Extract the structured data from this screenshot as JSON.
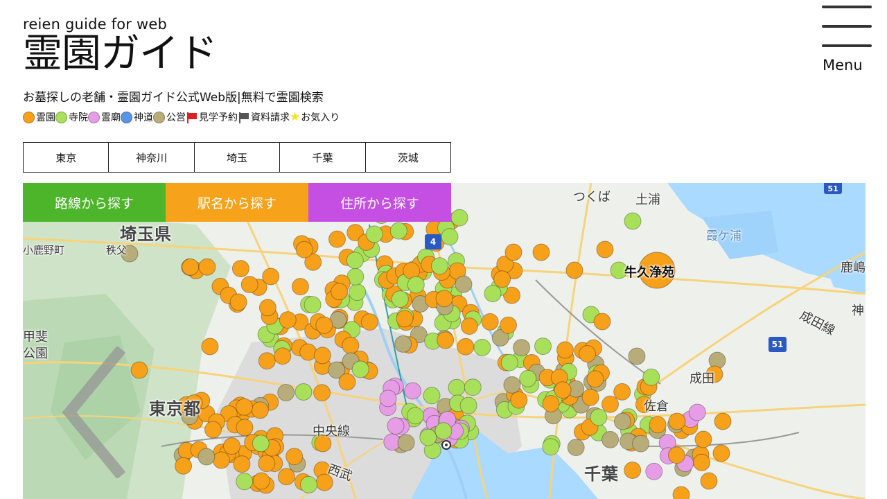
{
  "header": {
    "subtitle": "reien guide for web",
    "title": "霊園ガイド",
    "tagline": "お墓探しの老舗・霊園ガイド公式Web版|無料で霊園検索"
  },
  "legend": [
    {
      "label": "霊園",
      "icon": "orange-dot-icon",
      "color": "#f7a01a"
    },
    {
      "label": "寺院",
      "icon": "green-dot-icon",
      "color": "#a8e05a"
    },
    {
      "label": "霊廟",
      "icon": "pink-dot-icon",
      "color": "#e79ce6"
    },
    {
      "label": "神道",
      "icon": "blue-dot-icon",
      "color": "#5a94e8"
    },
    {
      "label": "公営",
      "icon": "olive-dot-icon",
      "color": "#b8ad79"
    },
    {
      "label": "見学予約",
      "icon": "red-flag-icon",
      "color": "#e02020"
    },
    {
      "label": "資料請求",
      "icon": "gray-flag-icon",
      "color": "#555555"
    },
    {
      "label": "お気入り",
      "icon": "star-icon",
      "color": "#f7e600"
    }
  ],
  "menu": {
    "label": "Menu"
  },
  "prefecture_tabs": [
    "東京",
    "神奈川",
    "埼玉",
    "千葉",
    "茨城"
  ],
  "search_tabs": [
    {
      "label": "路線から探す",
      "color": "#4cb52a"
    },
    {
      "label": "駅名から探す",
      "color": "#f7a21b"
    },
    {
      "label": "住所から探す",
      "color": "#c54ee3"
    }
  ],
  "map_labels": {
    "saitama": "埼玉県",
    "kanohara": "小鹿野町",
    "chichibu": "秩父",
    "tsukuba": "つくば",
    "tsuchiura": "土浦",
    "kasumigaura": "霞ケ浦",
    "ushiku": "牛久浄苑",
    "kashima": "鹿嶋",
    "kami": "神",
    "naritasen": "成田線",
    "kofu": "甲斐",
    "park": "公園",
    "tokyo": "東京都",
    "narita": "成田",
    "sakura": "佐倉",
    "chuosen": "中央線",
    "chiba": "千葉",
    "seibu": "西武",
    "route4": "4",
    "route51": "51",
    "route51b": "51"
  }
}
